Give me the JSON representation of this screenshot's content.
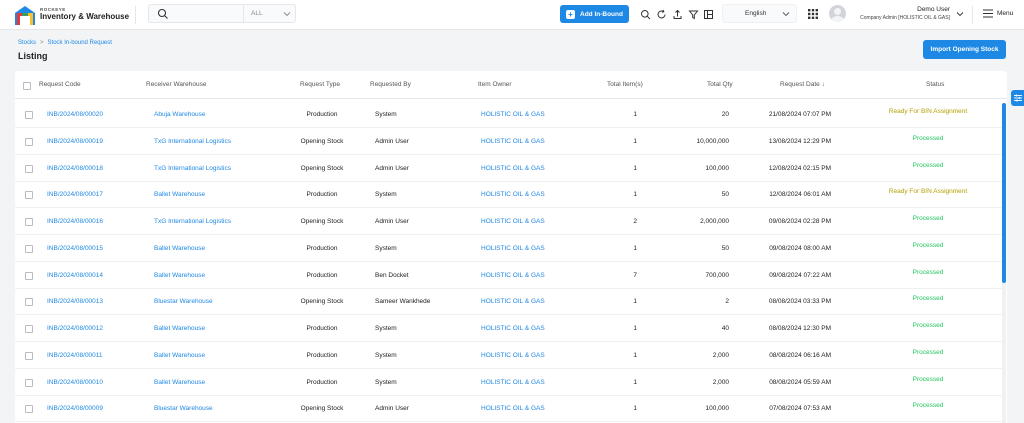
{
  "brand": {
    "small": "ROCKEYE",
    "name": "Inventory & Warehouse"
  },
  "search": {
    "value": "",
    "scope": "ALL"
  },
  "header": {
    "add_button": "Add In-Bound",
    "language": "English",
    "user_name": "Demo User",
    "user_role": "Company Admin [HOLISTIC OIL & GAS]",
    "menu_label": "Menu"
  },
  "breadcrumb": {
    "root": "Stocks",
    "current": "Stock In-bound Request"
  },
  "page": {
    "title": "Listing",
    "import_button": "Import Opening Stock"
  },
  "table": {
    "columns": {
      "code": "Request Code",
      "warehouse": "Receiver Warehouse",
      "type": "Request Type",
      "requested_by": "Requested By",
      "owner": "Item Owner",
      "items": "Total Item(s)",
      "qty": "Total Qty",
      "date": "Request Date",
      "status": "Status"
    },
    "rows": [
      {
        "code": "INB/2024/08/00020",
        "warehouse": "Abuja Warehouse",
        "type": "Production",
        "requested_by": "System",
        "owner": "HOLISTIC OIL & GAS",
        "items": "1",
        "qty": "20",
        "date": "21/08/2024 07:07 PM",
        "status": "Ready For BIN Assignment"
      },
      {
        "code": "INB/2024/08/00019",
        "warehouse": "TxG International Logistics",
        "type": "Opening Stock",
        "requested_by": "Admin User",
        "owner": "HOLISTIC OIL & GAS",
        "items": "1",
        "qty": "10,000,000",
        "date": "13/08/2024 12:29 PM",
        "status": "Processed"
      },
      {
        "code": "INB/2024/08/00018",
        "warehouse": "TxG International Logistics",
        "type": "Opening Stock",
        "requested_by": "Admin User",
        "owner": "HOLISTIC OIL & GAS",
        "items": "1",
        "qty": "100,000",
        "date": "12/08/2024 02:15 PM",
        "status": "Processed"
      },
      {
        "code": "INB/2024/08/00017",
        "warehouse": "Ballet Warehouse",
        "type": "Production",
        "requested_by": "System",
        "owner": "HOLISTIC OIL & GAS",
        "items": "1",
        "qty": "50",
        "date": "12/08/2024 06:01 AM",
        "status": "Ready For BIN Assignment"
      },
      {
        "code": "INB/2024/08/00016",
        "warehouse": "TxG International Logistics",
        "type": "Opening Stock",
        "requested_by": "Admin User",
        "owner": "HOLISTIC OIL & GAS",
        "items": "2",
        "qty": "2,000,000",
        "date": "09/08/2024 02:28 PM",
        "status": "Processed"
      },
      {
        "code": "INB/2024/08/00015",
        "warehouse": "Ballet Warehouse",
        "type": "Production",
        "requested_by": "System",
        "owner": "HOLISTIC OIL & GAS",
        "items": "1",
        "qty": "50",
        "date": "09/08/2024 08:00 AM",
        "status": "Processed"
      },
      {
        "code": "INB/2024/08/00014",
        "warehouse": "Ballet Warehouse",
        "type": "Production",
        "requested_by": "Ben Docket",
        "owner": "HOLISTIC OIL & GAS",
        "items": "7",
        "qty": "700,000",
        "date": "09/08/2024 07:22 AM",
        "status": "Processed"
      },
      {
        "code": "INB/2024/08/00013",
        "warehouse": "Bluestar Warehouse",
        "type": "Opening Stock",
        "requested_by": "Sameer Wankhede",
        "owner": "HOLISTIC OIL & GAS",
        "items": "1",
        "qty": "2",
        "date": "08/08/2024 03:33 PM",
        "status": "Processed"
      },
      {
        "code": "INB/2024/08/00012",
        "warehouse": "Ballet Warehouse",
        "type": "Production",
        "requested_by": "System",
        "owner": "HOLISTIC OIL & GAS",
        "items": "1",
        "qty": "40",
        "date": "08/08/2024 12:30 PM",
        "status": "Processed"
      },
      {
        "code": "INB/2024/08/00011",
        "warehouse": "Ballet Warehouse",
        "type": "Production",
        "requested_by": "System",
        "owner": "HOLISTIC OIL & GAS",
        "items": "1",
        "qty": "2,000",
        "date": "08/08/2024 06:16 AM",
        "status": "Processed"
      },
      {
        "code": "INB/2024/08/00010",
        "warehouse": "Ballet Warehouse",
        "type": "Production",
        "requested_by": "System",
        "owner": "HOLISTIC OIL & GAS",
        "items": "1",
        "qty": "2,000",
        "date": "08/08/2024 05:59 AM",
        "status": "Processed"
      },
      {
        "code": "INB/2024/08/00009",
        "warehouse": "Bluestar Warehouse",
        "type": "Opening Stock",
        "requested_by": "Admin User",
        "owner": "HOLISTIC OIL & GAS",
        "items": "1",
        "qty": "100,000",
        "date": "07/08/2024 07:53 AM",
        "status": "Processed"
      }
    ]
  },
  "colors": {
    "accent": "#1e88e5",
    "processed": "#22c55e",
    "ready": "#b5a000"
  }
}
